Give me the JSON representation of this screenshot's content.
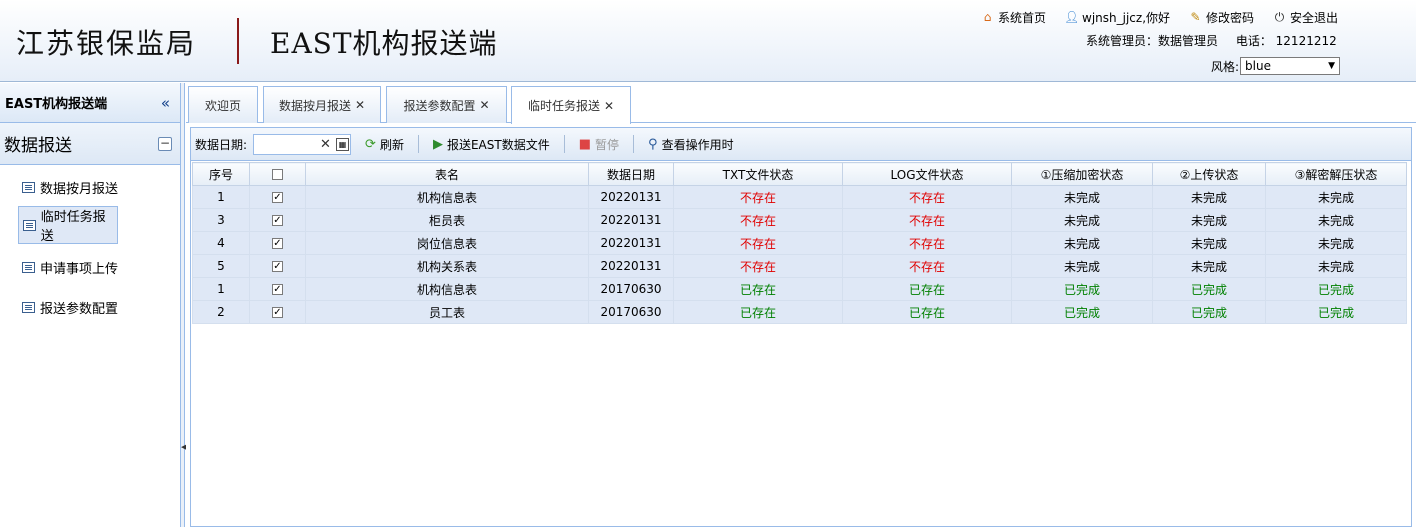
{
  "header": {
    "title_left": "江苏银保监局",
    "title_right": "EAST机构报送端",
    "links": [
      {
        "name": "home",
        "icon": "home-icon",
        "label": "系统首页"
      },
      {
        "name": "user",
        "icon": "user-icon",
        "label": "wjnsh_jjcz,你好"
      },
      {
        "name": "password",
        "icon": "edit-icon",
        "label": "修改密码"
      },
      {
        "name": "logout",
        "icon": "power-icon",
        "label": "安全退出"
      }
    ],
    "admin_text": "系统管理员：数据管理员",
    "phone_text": "电话：  12121212",
    "style_label": "风格:",
    "style_value": "blue"
  },
  "sidebar": {
    "title": "EAST机构报送端",
    "collapse_glyph": "«",
    "section_title": "数据报送",
    "items": [
      {
        "label": "数据按月报送",
        "active": false
      },
      {
        "label": "临时任务报送",
        "active": true
      },
      {
        "label": "申请事项上传",
        "active": false
      },
      {
        "label": "报送参数配置",
        "active": false
      }
    ]
  },
  "tabs": [
    {
      "label": "欢迎页",
      "closable": false
    },
    {
      "label": "数据按月报送",
      "closable": true
    },
    {
      "label": "报送参数配置",
      "closable": true
    },
    {
      "label": "临时任务报送",
      "closable": true,
      "active": true
    }
  ],
  "toolbar": {
    "date_label": "数据日期:",
    "date_value": "",
    "refresh_label": "刷新",
    "submit_label": "报送EAST数据文件",
    "pause_label": "暂停",
    "view_label": "查看操作用时"
  },
  "table": {
    "columns": [
      "序号",
      "",
      "表名",
      "数据日期",
      "TXT文件状态",
      "LOG文件状态",
      "①压缩加密状态",
      "②上传状态",
      "③解密解压状态"
    ],
    "rows": [
      {
        "no": "1",
        "checked": true,
        "name": "机构信息表",
        "date": "20220131",
        "txt": "不存在",
        "log": "不存在",
        "compress": "未完成",
        "upload": "未完成",
        "decrypt": "未完成"
      },
      {
        "no": "3",
        "checked": true,
        "name": "柜员表",
        "date": "20220131",
        "txt": "不存在",
        "log": "不存在",
        "compress": "未完成",
        "upload": "未完成",
        "decrypt": "未完成"
      },
      {
        "no": "4",
        "checked": true,
        "name": "岗位信息表",
        "date": "20220131",
        "txt": "不存在",
        "log": "不存在",
        "compress": "未完成",
        "upload": "未完成",
        "decrypt": "未完成"
      },
      {
        "no": "5",
        "checked": true,
        "name": "机构关系表",
        "date": "20220131",
        "txt": "不存在",
        "log": "不存在",
        "compress": "未完成",
        "upload": "未完成",
        "decrypt": "未完成"
      },
      {
        "no": "1",
        "checked": true,
        "name": "机构信息表",
        "date": "20170630",
        "txt": "已存在",
        "log": "已存在",
        "compress": "已完成",
        "upload": "已完成",
        "decrypt": "已完成"
      },
      {
        "no": "2",
        "checked": true,
        "name": "员工表",
        "date": "20170630",
        "txt": "已存在",
        "log": "已存在",
        "compress": "已完成",
        "upload": "已完成",
        "decrypt": "已完成"
      }
    ]
  },
  "colors": {
    "missing": "#e00000",
    "present": "#008000",
    "accent": "#99bbe8"
  }
}
